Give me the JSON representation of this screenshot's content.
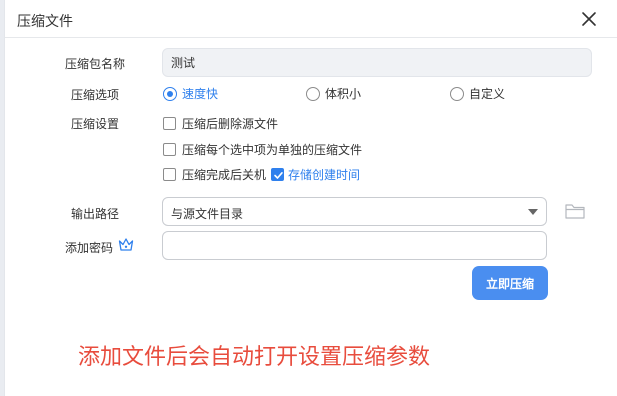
{
  "dialog": {
    "title": "压缩文件"
  },
  "form": {
    "name_label": "压缩包名称",
    "name_value": "测试",
    "options_label": "压缩选项",
    "options": [
      {
        "label": "速度快",
        "checked": true
      },
      {
        "label": "体积小",
        "checked": false
      },
      {
        "label": "自定义",
        "checked": false
      }
    ],
    "settings_label": "压缩设置",
    "settings": [
      {
        "label": "压缩后删除源文件",
        "checked": false
      },
      {
        "label": "压缩每个选中项为单独的压缩文件",
        "checked": false
      },
      {
        "label": "压缩完成后关机",
        "checked": false
      },
      {
        "label": "存储创建时间",
        "checked": true
      }
    ],
    "output_label": "输出路径",
    "output_value": "与源文件目录",
    "password_label": "添加密码",
    "password_value": "",
    "submit_label": "立即压缩"
  },
  "annotation": {
    "text": "添加文件后会自动打开设置压缩参数"
  },
  "colors": {
    "accent": "#2f80ed",
    "button": "#4a8ef0",
    "annotation": "#e84c3d"
  },
  "icons": [
    "close-icon",
    "chevron-down-icon",
    "folder-icon",
    "vip-crown-icon",
    "checkmark-icon"
  ]
}
